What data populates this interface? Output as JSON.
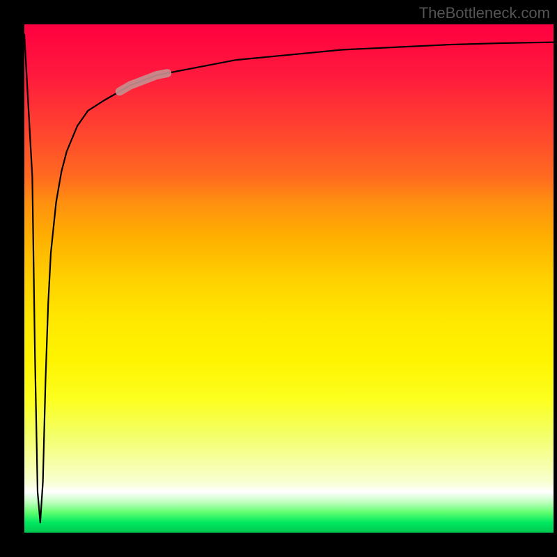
{
  "watermark": "TheBottleneck.com",
  "chart_data": {
    "type": "line",
    "title": "",
    "xlabel": "",
    "ylabel": "",
    "xlim": [
      0,
      100
    ],
    "ylim": [
      0,
      100
    ],
    "grid": false,
    "series": [
      {
        "name": "curve",
        "x": [
          0,
          1.5,
          2,
          2.5,
          3,
          3.5,
          4,
          4.5,
          5,
          6,
          7,
          8,
          10,
          12,
          15,
          20,
          25,
          30,
          40,
          50,
          60,
          70,
          80,
          90,
          100
        ],
        "values": [
          98,
          70,
          35,
          8,
          2,
          10,
          30,
          45,
          55,
          65,
          71,
          75,
          80,
          83,
          85,
          88,
          90,
          91,
          93,
          94,
          95,
          95.5,
          96,
          96.3,
          96.5
        ]
      }
    ],
    "highlight_region": {
      "x_range": [
        18,
        27
      ],
      "description": "thick muted-red overlay segment on rising part of curve"
    },
    "background_gradient": {
      "top": "#ff0040",
      "mid": "#fff400",
      "bottom_band": "#00e860",
      "white_band_y": 92
    }
  }
}
